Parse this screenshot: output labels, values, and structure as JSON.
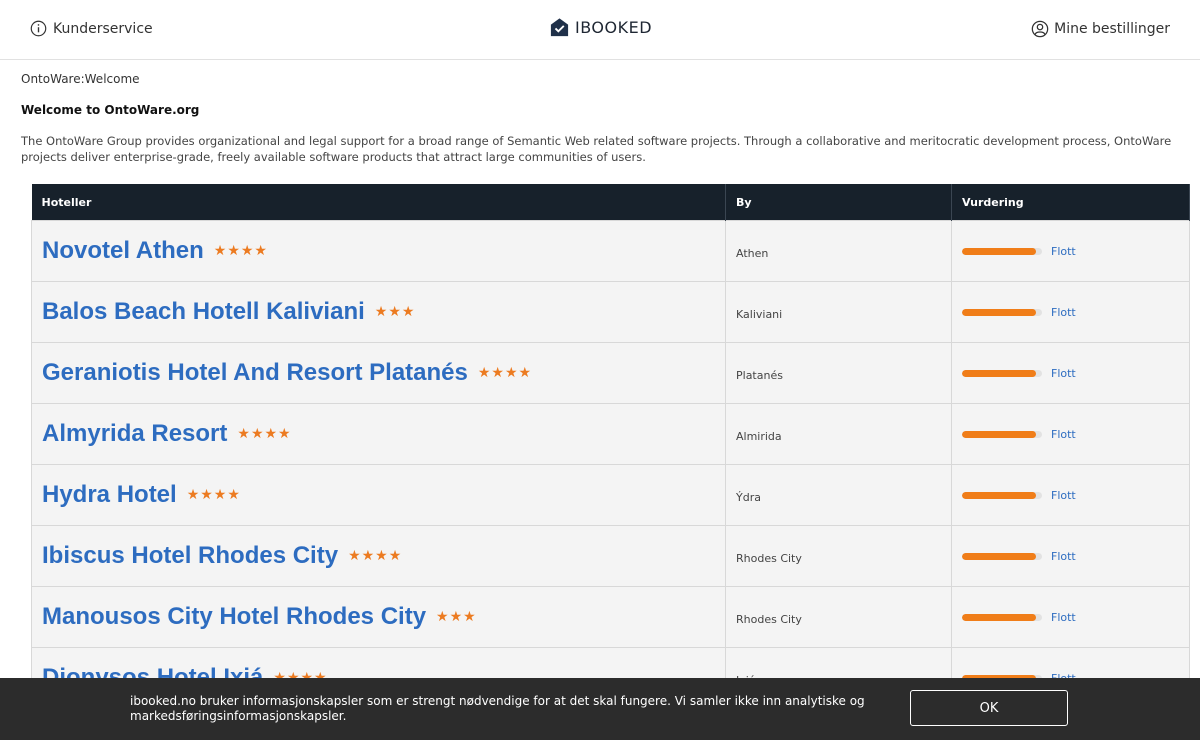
{
  "header": {
    "customer_service": "Kunderservice",
    "logo_text": "IBOOKED",
    "my_bookings": "Mine bestillinger"
  },
  "page": {
    "breadcrumb": "OntoWare:Welcome",
    "title": "Welcome to OntoWare.org",
    "intro": "The OntoWare Group provides organizational and legal support for a broad range of Semantic Web related software projects. Through a collaborative and meritocratic development process, OntoWare projects deliver enterprise-grade, freely available software products that attract large communities of users."
  },
  "table": {
    "headers": [
      "Hoteller",
      "By",
      "Vurdering"
    ],
    "rows": [
      {
        "name": "Novotel Athen",
        "stars": "★★★★",
        "city": "Athen",
        "rating": "Flott",
        "score": 0.92
      },
      {
        "name": "Balos Beach Hotell Kaliviani",
        "stars": "★★★",
        "city": "Kaliviani",
        "rating": "Flott",
        "score": 0.92
      },
      {
        "name": "Geraniotis Hotel And Resort Platanés",
        "stars": "★★★★",
        "city": "Platanés",
        "rating": "Flott",
        "score": 0.92
      },
      {
        "name": "Almyrida Resort",
        "stars": "★★★★",
        "city": "Almirida",
        "rating": "Flott",
        "score": 0.92
      },
      {
        "name": "Hydra Hotel",
        "stars": "★★★★",
        "city": "Ýdra",
        "rating": "Flott",
        "score": 0.92
      },
      {
        "name": "Ibiscus Hotel Rhodes City",
        "stars": "★★★★",
        "city": "Rhodes City",
        "rating": "Flott",
        "score": 0.92
      },
      {
        "name": "Manousos City Hotel Rhodes City",
        "stars": "★★★",
        "city": "Rhodes City",
        "rating": "Flott",
        "score": 0.92
      },
      {
        "name": "Dionysos Hotel Ixiá",
        "stars": "★★★★",
        "city": "Ixiá",
        "rating": "Flott",
        "score": 0.92
      }
    ]
  },
  "cookie": {
    "text": "ibooked.no bruker informasjonskapsler som er strengt nødvendige for at det skal fungere. Vi samler ikke inn analytiske og markedsføringsinformasjonskapsler.",
    "ok_label": "OK"
  },
  "colors": {
    "header_bg": "#17212b",
    "link": "#2d6cc0",
    "star": "#ec7b21",
    "bar_fill": "#f07d18",
    "cookie_bg": "#2c2c2c"
  }
}
